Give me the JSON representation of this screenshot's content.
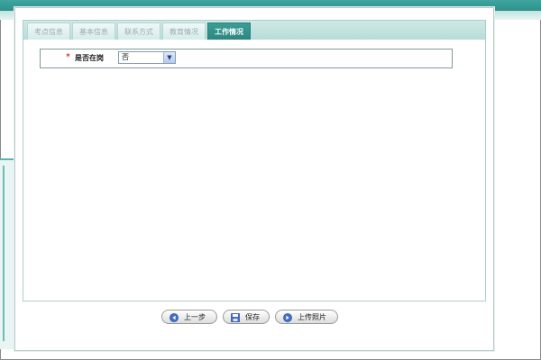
{
  "tabs": [
    {
      "label": "考点信息",
      "active": false
    },
    {
      "label": "基本信息",
      "active": false
    },
    {
      "label": "联系方式",
      "active": false
    },
    {
      "label": "教育情况",
      "active": false
    },
    {
      "label": "工作情况",
      "active": true
    }
  ],
  "form": {
    "required_mark": "*",
    "on_duty_label": "是否在岗",
    "on_duty_value": "否"
  },
  "buttons": {
    "prev_label": "上一步",
    "save_label": "保存",
    "upload_label": "上传照片"
  },
  "colors": {
    "accent_teal": "#2d8680",
    "tab_strip": "#b6dcd8",
    "required": "#d40000"
  },
  "icons": {
    "prev": "arrow-left-circle-icon",
    "save": "floppy-disk-icon",
    "upload": "arrow-right-circle-icon",
    "dropdown": "chevron-down-icon"
  }
}
